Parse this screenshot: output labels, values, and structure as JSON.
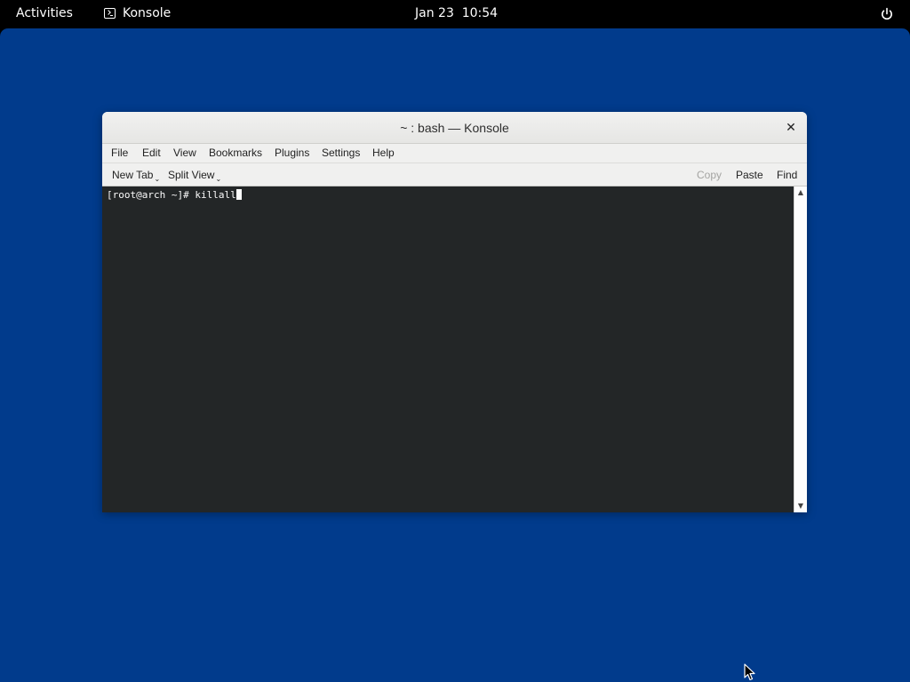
{
  "topbar": {
    "activities_label": "Activities",
    "app_name": "Konsole",
    "clock": "Jan 23  10:54",
    "app_icon": "terminal-icon",
    "power_icon": "power-icon"
  },
  "colors": {
    "desktop_background": "#013b8c",
    "terminal_background": "#232627",
    "terminal_foreground": "#fcfcfc"
  },
  "window": {
    "title": "~ : bash — Konsole",
    "close_glyph": "✕",
    "menubar": {
      "items": [
        "File",
        "Edit",
        "View",
        "Bookmarks",
        "Plugins",
        "Settings",
        "Help"
      ]
    },
    "toolbar": {
      "new_tab_label": "New Tab",
      "split_view_label": "Split View",
      "dropdown_glyph": "⌄",
      "copy_label": "Copy",
      "paste_label": "Paste",
      "find_label": "Find"
    },
    "terminal": {
      "prompt": "[root@arch ~]# ",
      "command": "killall"
    },
    "scrollbar": {
      "up_glyph": "▲",
      "down_glyph": "▼"
    }
  }
}
